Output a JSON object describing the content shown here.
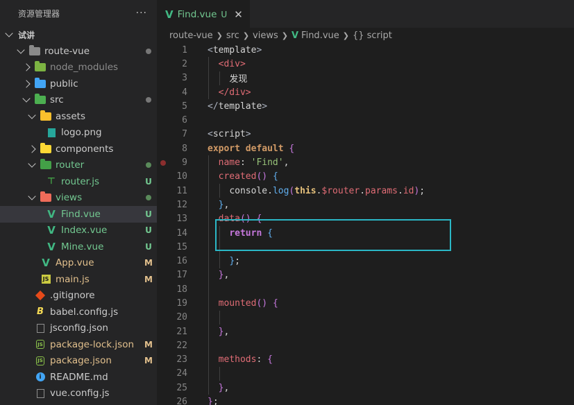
{
  "sidebar": {
    "title": "资源管理器",
    "more": "···",
    "section": "试讲",
    "items": [
      {
        "label": "route-vue",
        "badge": ""
      },
      {
        "label": "node_modules",
        "badge": ""
      },
      {
        "label": "public",
        "badge": ""
      },
      {
        "label": "src",
        "badge": ""
      },
      {
        "label": "assets",
        "badge": ""
      },
      {
        "label": "logo.png",
        "badge": ""
      },
      {
        "label": "components",
        "badge": ""
      },
      {
        "label": "router",
        "badge": ""
      },
      {
        "label": "router.js",
        "badge": "U"
      },
      {
        "label": "views",
        "badge": ""
      },
      {
        "label": "Find.vue",
        "badge": "U"
      },
      {
        "label": "Index.vue",
        "badge": "U"
      },
      {
        "label": "Mine.vue",
        "badge": "U"
      },
      {
        "label": "App.vue",
        "badge": "M"
      },
      {
        "label": "main.js",
        "badge": "M"
      },
      {
        "label": ".gitignore",
        "badge": ""
      },
      {
        "label": "babel.config.js",
        "badge": ""
      },
      {
        "label": "jsconfig.json",
        "badge": ""
      },
      {
        "label": "package-lock.json",
        "badge": "M"
      },
      {
        "label": "package.json",
        "badge": "M"
      },
      {
        "label": "README.md",
        "badge": ""
      },
      {
        "label": "vue.config.js",
        "badge": ""
      }
    ]
  },
  "tab": {
    "title": "Find.vue",
    "flag": "U",
    "close": "✕"
  },
  "breadcrumb": {
    "parts": [
      "route-vue",
      "src",
      "views",
      "Find.vue",
      "{} script"
    ]
  },
  "editor": {
    "line_numbers": [
      "1",
      "2",
      "3",
      "4",
      "5",
      "6",
      "7",
      "8",
      "9",
      "10",
      "11",
      "12",
      "13",
      "14",
      "15",
      "16",
      "17",
      "18",
      "19",
      "20",
      "21",
      "22",
      "23",
      "24",
      "25",
      "26"
    ]
  },
  "colors": {
    "accent_highlight": "#2bb7c6",
    "untracked": "#73c991",
    "modified": "#e2c08d"
  }
}
